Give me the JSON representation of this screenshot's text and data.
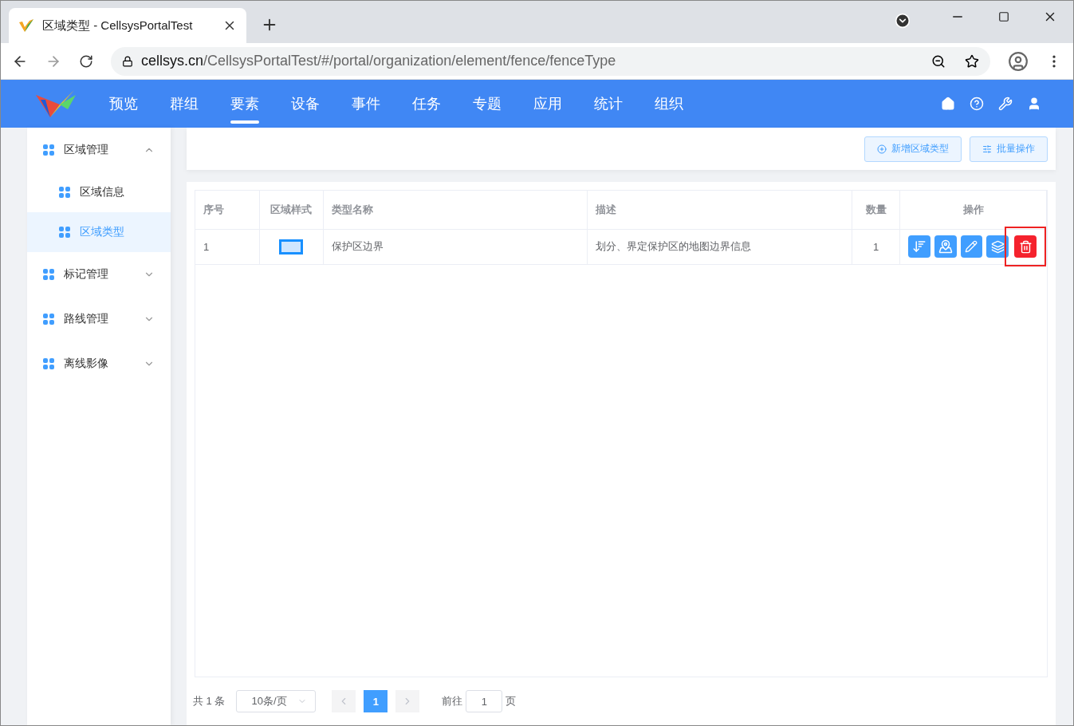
{
  "browser": {
    "tab_title": "区域类型 - CellsysPortalTest",
    "url_host": "cellsys.cn",
    "url_path": "/CellsysPortalTest/#/portal/organization/element/fence/fenceType"
  },
  "nav": {
    "items": [
      {
        "label": "预览",
        "selected": false
      },
      {
        "label": "群组",
        "selected": false
      },
      {
        "label": "要素",
        "selected": true
      },
      {
        "label": "设备",
        "selected": false
      },
      {
        "label": "事件",
        "selected": false
      },
      {
        "label": "任务",
        "selected": false
      },
      {
        "label": "专题",
        "selected": false
      },
      {
        "label": "应用",
        "selected": false
      },
      {
        "label": "统计",
        "selected": false
      },
      {
        "label": "组织",
        "selected": false
      }
    ]
  },
  "sidebar": {
    "groups": [
      {
        "label": "区域管理",
        "expanded": true,
        "children": [
          {
            "label": "区域信息",
            "selected": false
          },
          {
            "label": "区域类型",
            "selected": true
          }
        ]
      },
      {
        "label": "标记管理",
        "expanded": false
      },
      {
        "label": "路线管理",
        "expanded": false
      },
      {
        "label": "离线影像",
        "expanded": false
      }
    ]
  },
  "toolbar": {
    "buttons": [
      {
        "label": "新增区域类型",
        "kind": "add"
      },
      {
        "label": "批量操作",
        "kind": "batch"
      }
    ]
  },
  "table": {
    "columns": [
      "序号",
      "区域样式",
      "类型名称",
      "描述",
      "数量",
      "操作"
    ],
    "rows": [
      {
        "index": "1",
        "color": "#1890ff",
        "name": "保护区边界",
        "description": "划分、界定保护区的地图边界信息",
        "count": "1",
        "actions": [
          {
            "kind": "sort",
            "highlighted": false
          },
          {
            "kind": "map",
            "highlighted": false
          },
          {
            "kind": "edit",
            "highlighted": false
          },
          {
            "kind": "layers",
            "highlighted": false
          },
          {
            "kind": "delete",
            "highlighted": true
          }
        ]
      }
    ]
  },
  "pagination": {
    "total": "共 1 条",
    "page_size": "10条/页",
    "pages": [
      {
        "label": "1",
        "selected": true
      }
    ],
    "goto_label": "前往",
    "goto_value": "1",
    "goto_suffix": "页"
  }
}
